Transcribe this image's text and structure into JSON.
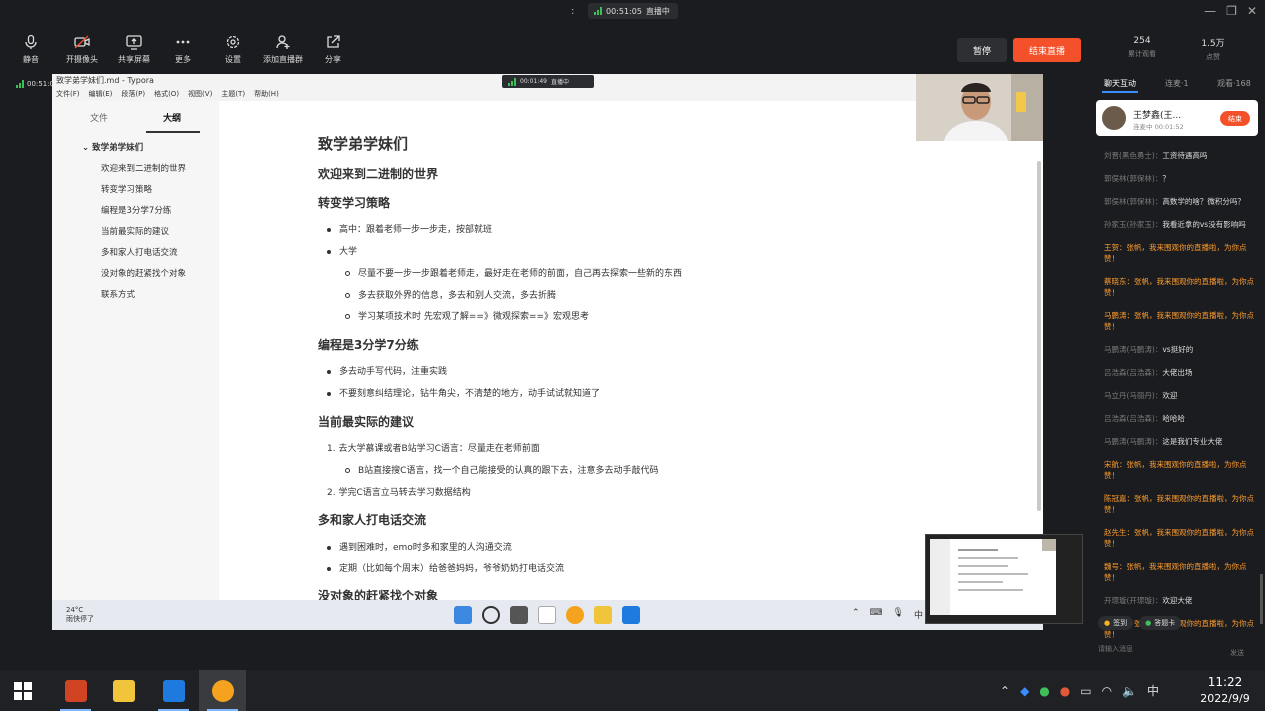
{
  "topbar": {
    "live_time": "00:51:05",
    "live_status": "直播中",
    "menu_dot": ":"
  },
  "toolbar": {
    "items": [
      {
        "label": "静音",
        "icon": "microphone-icon"
      },
      {
        "label": "开摄像头",
        "icon": "camera-off-icon"
      },
      {
        "label": "共享屏幕",
        "icon": "share-screen-icon"
      },
      {
        "label": "更多",
        "icon": "more-icon"
      },
      {
        "label": "设置",
        "icon": "gear-icon"
      },
      {
        "label": "添加直播群",
        "icon": "add-group-icon"
      },
      {
        "label": "分享",
        "icon": "share-icon"
      }
    ],
    "pause_label": "暂停",
    "end_label": "结束直播"
  },
  "stats": {
    "total_views_value": "254",
    "total_views_label": "累计观看",
    "likes_value": "1.5万",
    "likes_label": "点赞"
  },
  "live_left": {
    "time": "00:51:05"
  },
  "typora": {
    "title": "致学弟学妹们.md - Typora",
    "menu": [
      "文件(F)",
      "编辑(E)",
      "段落(P)",
      "格式(O)",
      "视图(V)",
      "主题(T)",
      "帮助(H)"
    ],
    "inner_live_time": "00:01:49",
    "inner_live_status": "直播中",
    "side_tabs": {
      "files": "文件",
      "outline": "大纲"
    },
    "outline_top": "致学弟学妹们",
    "outline_items": [
      "欢迎来到二进制的世界",
      "转变学习策略",
      "编程是3分学7分练",
      "当前最实际的建议",
      "多和家人打电话交流",
      "没对象的赶紧找个对象",
      "联系方式"
    ],
    "side_foot": {
      "back": "‹",
      "source": "</>"
    },
    "doc": {
      "h1": "致学弟学妹们",
      "s1": "欢迎来到二进制的世界",
      "s2": "转变学习策略",
      "s2_items": [
        "高中：跟着老师一步一步走，按部就班",
        "大学"
      ],
      "s2_sub": [
        "尽量不要一步一步跟着老师走，最好走在老师的前面，自己再去探索一些新的东西",
        "多去获取外界的信息，多去和别人交流，多去折腾",
        "学习某项技术时 先宏观了解==》微观探索==》宏观思考"
      ],
      "s3": "编程是3分学7分练",
      "s3_items": [
        "多去动手写代码，注重实践",
        "不要刻意纠结理论，钻牛角尖，不清楚的地方，动手试试就知道了"
      ],
      "s4": "当前最实际的建议",
      "s4_items": [
        "1. 去大学慕课或者B站学习C语言：尽量走在老师前面",
        "2. 学完C语言立马转去学习数据结构"
      ],
      "s4_sub": "B站直接搜C语言，找一个自己能接受的认真的跟下去，注意多去动手敲代码",
      "s5": "多和家人打电话交流",
      "s5_items": [
        "遇到困难时，emo时多和家里的人沟通交流",
        "定期（比如每个周末）给爸爸妈妈，爷爷奶奶打电话交流"
      ],
      "s6": "没对象的赶紧找个对象"
    },
    "weather": {
      "temp": "24°C",
      "desc": "雨快停了"
    },
    "tray_text": "中"
  },
  "panel": {
    "tabs": [
      "聊天互动",
      "连麦·1",
      "观看·168"
    ],
    "guest_name": "王梦鑫(王...",
    "guest_status": "连麦中 00:01:52",
    "guest_end": "结束",
    "messages": [
      {
        "who": "刘晋(黑色勇士)：",
        "text": "工资待遇高吗",
        "gift": false
      },
      {
        "who": "郭俣林(郭保林)：",
        "text": "？",
        "gift": false
      },
      {
        "who": "郭俣林(郭保林)：",
        "text": "高数学的啥？微积分吗？",
        "gift": false
      },
      {
        "who": "孙家玉(孙家玉)：",
        "text": "我看近拿的vs没有影响吗",
        "gift": false
      },
      {
        "who": "王贺：",
        "text": "张帆，我来围观你的直播啦，为你点赞！",
        "gift": true
      },
      {
        "who": "蔡晓东：",
        "text": "张帆，我来围观你的直播啦，为你点赞！",
        "gift": true
      },
      {
        "who": "马鹏涛：",
        "text": "张帆，我来围观你的直播啦，为你点赞！",
        "gift": true
      },
      {
        "who": "马鹏涛(马鹏涛)：",
        "text": "vs挺好的",
        "gift": false
      },
      {
        "who": "吕浩森(吕浩森)：",
        "text": "大佬出场",
        "gift": false
      },
      {
        "who": "马立丹(马丽丹)：",
        "text": "欢迎",
        "gift": false
      },
      {
        "who": "吕浩森(吕浩森)：",
        "text": "哈哈哈",
        "gift": false
      },
      {
        "who": "马鹏涛(马鹏涛)：",
        "text": "这是我们专业大佬",
        "gift": false
      },
      {
        "who": "宋航：",
        "text": "张帆，我来围观你的直播啦，为你点赞！",
        "gift": true
      },
      {
        "who": "陈冠嘉：",
        "text": "张帆，我来围观你的直播啦，为你点赞！",
        "gift": true
      },
      {
        "who": "赵先生：",
        "text": "张帆，我来围观你的直播啦，为你点赞！",
        "gift": true
      },
      {
        "who": "魏号：",
        "text": "张帆，我来围观你的直播啦，为你点赞！",
        "gift": true
      },
      {
        "who": "开璟璇(开璟璇)：",
        "text": "欢迎大佬",
        "gift": false
      },
      {
        "who": "郭春阳：",
        "text": "张帆，我来围观你的直播啦，为你点赞！",
        "gift": true
      }
    ],
    "signin_label": "签到",
    "answer_label": "答题卡",
    "input_placeholder": "请输入消息",
    "send_label": "发送"
  },
  "taskbar": {
    "clock_time": "11:22",
    "clock_date": "2022/9/9",
    "ime": "中"
  }
}
